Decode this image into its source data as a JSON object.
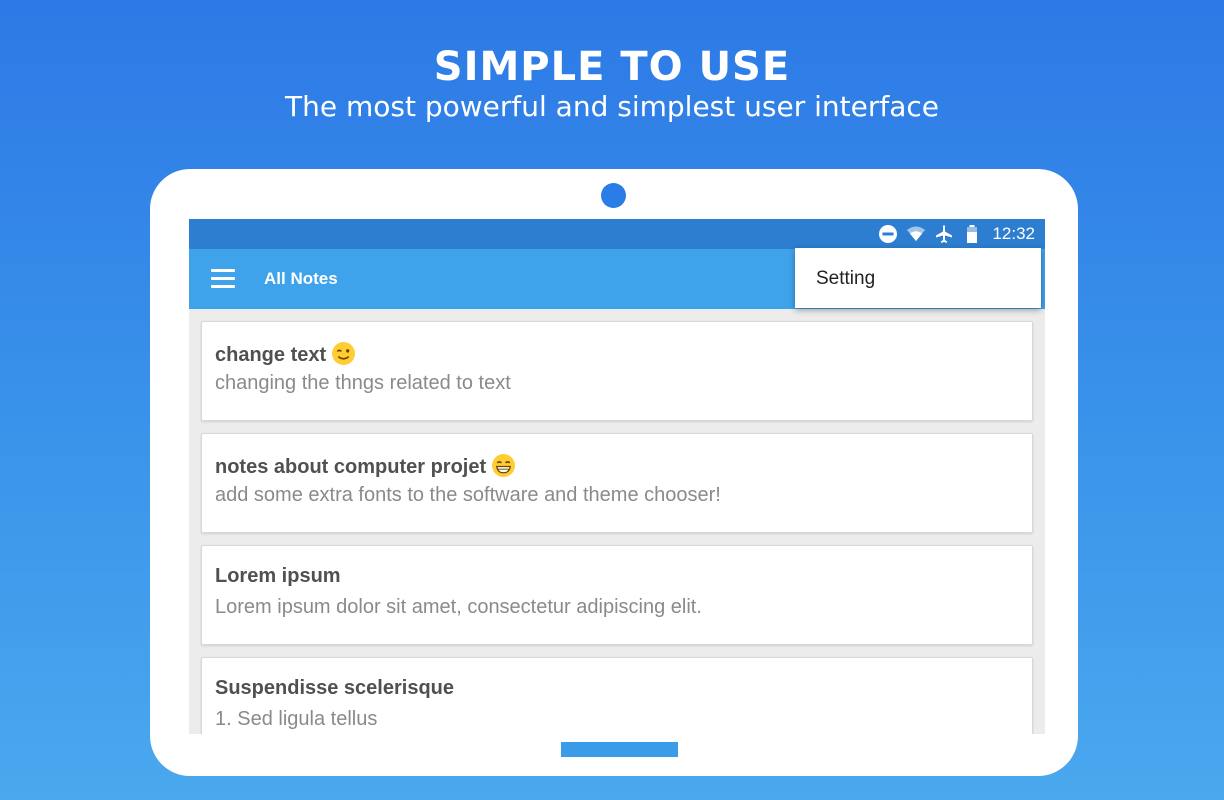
{
  "headline": "SIMPLE TO USE",
  "subheadline": "The most powerful and simplest user interface",
  "status_bar": {
    "time": "12:32",
    "icons": [
      "do-not-disturb-icon",
      "wifi-icon",
      "airplane-mode-icon",
      "battery-icon"
    ]
  },
  "app_bar": {
    "title": "All Notes",
    "menu_icon": "hamburger-menu-icon"
  },
  "overflow_menu": {
    "items": [
      {
        "label": "Setting"
      }
    ]
  },
  "notes": [
    {
      "title": "change text",
      "emoji": "winking-face",
      "body": "changing the thngs related to text"
    },
    {
      "title": "notes about computer projet",
      "emoji": "grinning-face",
      "body": "add some extra fonts to the software and theme chooser!"
    },
    {
      "title": "Lorem ipsum",
      "body": "Lorem ipsum dolor sit amet, consectetur adipiscing elit."
    },
    {
      "title": "Suspendisse scelerisque",
      "body": "1. Sed ligula tellus"
    }
  ],
  "colors": {
    "background_top": "#2d79e6",
    "background_bottom": "#4aa8ee",
    "status_bar": "#2d7ed0",
    "app_bar": "#3fa3ec",
    "list_background": "#ececec"
  }
}
